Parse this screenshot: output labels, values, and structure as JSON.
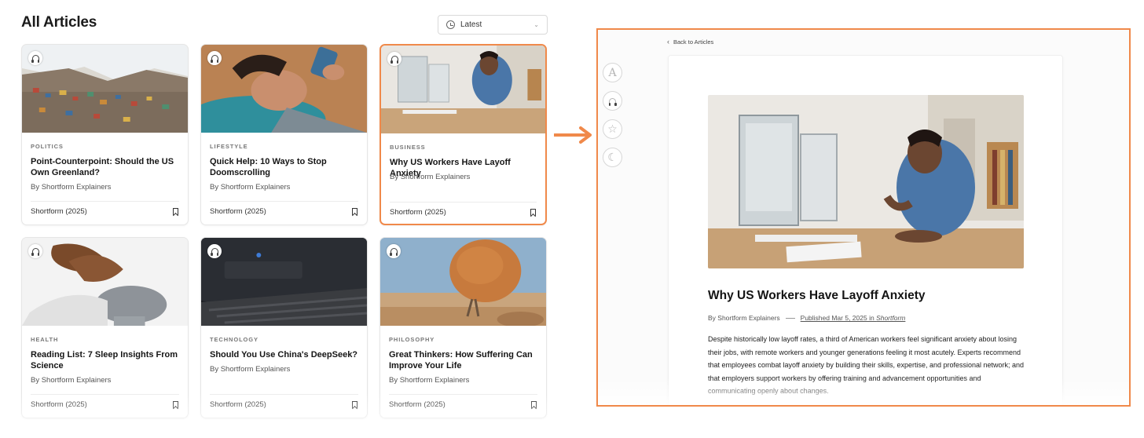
{
  "header": {
    "title": "All Articles",
    "sort_label": "Latest"
  },
  "cards": [
    {
      "category": "POLITICS",
      "title": "Point-Counterpoint: Should the US Own Greenland?",
      "byline": "By Shortform Explainers",
      "source": "Shortform (2025)"
    },
    {
      "category": "LIFESTYLE",
      "title": "Quick Help: 10 Ways to Stop Doomscrolling",
      "byline": "By Shortform Explainers",
      "source": "Shortform (2025)"
    },
    {
      "category": "BUSINESS",
      "title": "Why US Workers Have Layoff Anxiety",
      "byline": "By Shortform Explainers",
      "source": "Shortform (2025)"
    },
    {
      "category": "HEALTH",
      "title": "Reading List: 7 Sleep Insights From Science",
      "byline": "By Shortform Explainers",
      "source": "Shortform (2025)"
    },
    {
      "category": "TECHNOLOGY",
      "title": "Should You Use China's DeepSeek?",
      "byline": "By Shortform Explainers",
      "source": "Shortform (2025)"
    },
    {
      "category": "PHILOSOPHY",
      "title": "Great Thinkers: How Suffering Can Improve Your Life",
      "byline": "By Shortform Explainers",
      "source": "Shortform (2025)"
    }
  ],
  "detail": {
    "back_label": "Back to Articles",
    "title": "Why US Workers Have Layoff Anxiety",
    "author": "By Shortform Explainers",
    "published_prefix": "Published Mar 5, 2025 in ",
    "publication": "Shortform",
    "summary": "Despite historically low layoff rates, a third of American workers feel significant anxiety about losing their jobs, with remote workers and younger generations feeling it most acutely. Experts recommend that employees combat layoff anxiety by building their skills, expertise, and professional network; and that employers support workers by offering training and advancement opportunities and communicating openly about changes."
  },
  "colors": {
    "highlight": "#f0894a"
  },
  "icons": [
    "clock-icon",
    "chevron-down-icon",
    "headphones-icon",
    "bookmark-icon",
    "arrow-right-icon",
    "font-size-icon",
    "star-icon",
    "moon-icon",
    "chevron-left-icon"
  ]
}
